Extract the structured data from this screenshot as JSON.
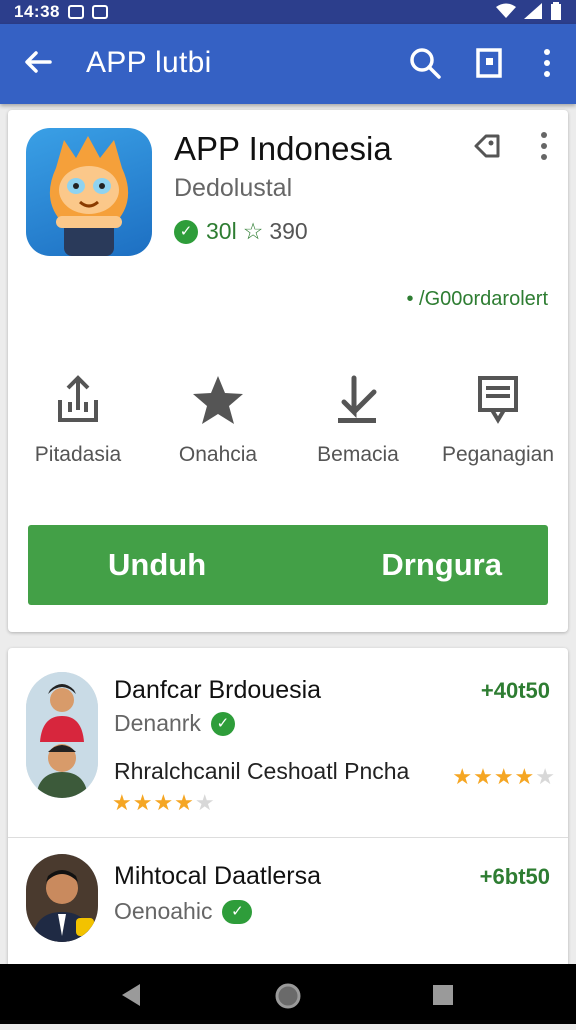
{
  "status_bar": {
    "time": "14:38"
  },
  "app_bar": {
    "title": "APP lutbi"
  },
  "app": {
    "name": "APP Indonesia",
    "developer": "Dedolustal",
    "rating_count": "30l",
    "rating_value": "390",
    "tag": "• /G00ordarolert"
  },
  "actions": [
    {
      "label": "Pitadasia",
      "icon": "share-upload-icon"
    },
    {
      "label": "Onahcia",
      "icon": "star-icon"
    },
    {
      "label": "Bemacia",
      "icon": "download-icon"
    },
    {
      "label": "Peganagian",
      "icon": "report-icon"
    }
  ],
  "install": {
    "left_label": "Unduh",
    "right_label": "Drngura"
  },
  "list": [
    {
      "title": "Danfcar Brdouesia",
      "subtitle": "Denanrk",
      "desc": "Rhralchcanil Ceshoatl Pncha",
      "price": "+40t50",
      "stars_a": "★★★★",
      "stars_b": "★★★★"
    },
    {
      "title": "Mihtocal Daatlersa",
      "subtitle": "Oenoahic",
      "price": "+6bt50"
    }
  ],
  "colors": {
    "primary": "#3561c4",
    "status": "#2c3e8c",
    "install": "#43a047",
    "accent_green": "#2e7d32",
    "star": "#f5a623"
  }
}
